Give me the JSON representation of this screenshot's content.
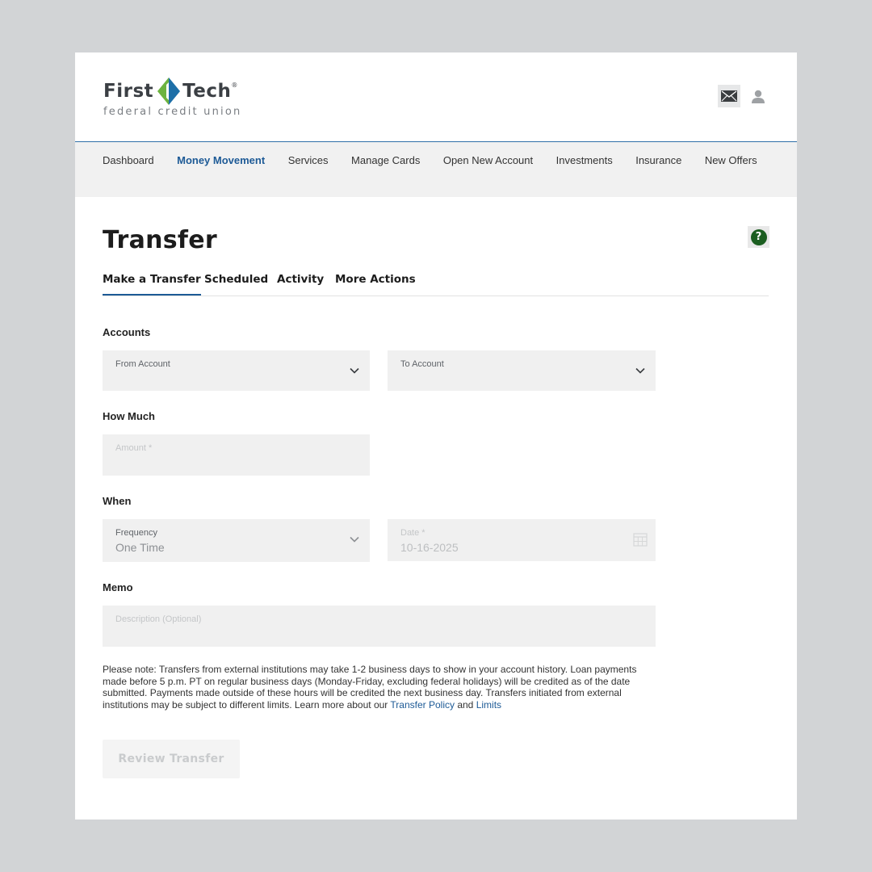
{
  "header": {
    "logo": {
      "word_left": "First",
      "word_right": "Tech",
      "registered": "®",
      "tagline": "federal credit union",
      "brand_colors": {
        "left_leaf": "#6db33f",
        "right_leaf": "#1d6fa8",
        "text": "#3b3f44"
      }
    },
    "icons": {
      "messages": "mail-icon",
      "profile": "user-icon"
    }
  },
  "nav": {
    "items": [
      {
        "label": "Dashboard",
        "active": false
      },
      {
        "label": "Money Movement",
        "active": true
      },
      {
        "label": "Services",
        "active": false
      },
      {
        "label": "Manage Cards",
        "active": false
      },
      {
        "label": "Open New Account",
        "active": false
      },
      {
        "label": "Investments",
        "active": false
      },
      {
        "label": "Insurance",
        "active": false
      },
      {
        "label": "New Offers",
        "active": false
      }
    ],
    "active_color": "#1d5a96"
  },
  "page": {
    "title": "Transfer",
    "help_symbol": "?",
    "tabs": [
      {
        "label": "Make a Transfer",
        "active": true
      },
      {
        "label": "Scheduled",
        "active": false
      },
      {
        "label": "Activity",
        "active": false
      },
      {
        "label": "More Actions",
        "active": false
      }
    ]
  },
  "form": {
    "accounts": {
      "label": "Accounts",
      "from_label": "From Account",
      "to_label": "To Account"
    },
    "how_much": {
      "label": "How Much",
      "amount_label": "Amount  *"
    },
    "when": {
      "label": "When",
      "frequency_label": "Frequency",
      "frequency_value": "One Time",
      "date_label": "Date  *",
      "date_value": "10-16-2025"
    },
    "memo": {
      "label": "Memo",
      "description_label": "Description (Optional)"
    }
  },
  "note": {
    "text": "Please note: Transfers from external institutions may take 1-2 business days to show in your account history. Loan payments made before 5 p.m. PT on regular business days (Monday-Friday, excluding federal holidays) will be credited as of the date submitted. Payments made outside of these hours will be credited the next business day. Transfers initiated from external institutions may be subject to different limits. Learn more about our ",
    "link1": "Transfer Policy",
    "conj": " and ",
    "link2": "Limits"
  },
  "actions": {
    "review_label": "Review Transfer",
    "review_enabled": false
  }
}
